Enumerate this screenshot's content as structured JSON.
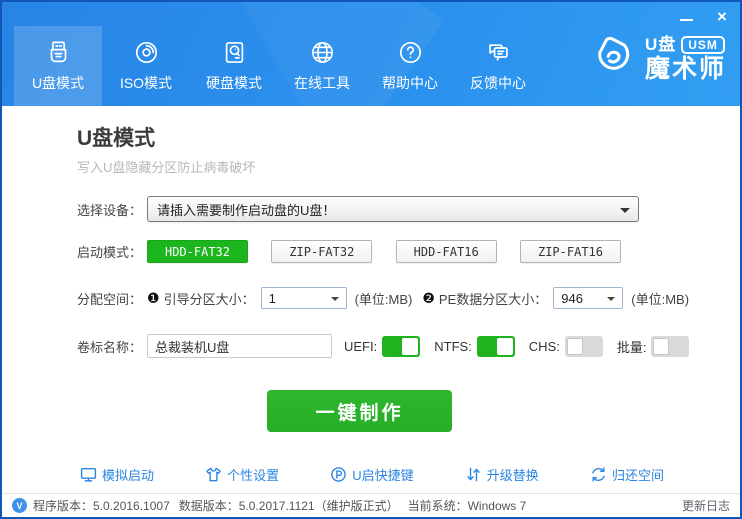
{
  "window": {
    "minimize_label": "minimize",
    "close_glyph": "×"
  },
  "nav": {
    "items": [
      {
        "label": "U盘模式",
        "icon": "usb-drive-icon",
        "active": true
      },
      {
        "label": "ISO模式",
        "icon": "disc-icon",
        "active": false
      },
      {
        "label": "硬盘模式",
        "icon": "hard-disk-icon",
        "active": false
      },
      {
        "label": "在线工具",
        "icon": "globe-icon",
        "active": false
      },
      {
        "label": "帮助中心",
        "icon": "question-icon",
        "active": false
      },
      {
        "label": "反馈中心",
        "icon": "feedback-icon",
        "active": false
      }
    ]
  },
  "logo": {
    "product": "U盘",
    "badge": "USM",
    "brand": "魔术师"
  },
  "main": {
    "title": "U盘模式",
    "subtitle": "写入U盘隐藏分区防止病毒破坏",
    "device": {
      "label": "选择设备：",
      "value": "请插入需要制作启动盘的U盘！"
    },
    "boot_mode": {
      "label": "启动模式：",
      "options": [
        {
          "label": "HDD-FAT32",
          "selected": true
        },
        {
          "label": "ZIP-FAT32",
          "selected": false
        },
        {
          "label": "HDD-FAT16",
          "selected": false
        },
        {
          "label": "ZIP-FAT16",
          "selected": false
        }
      ]
    },
    "allocation": {
      "label": "分配空间：",
      "boot_partition": {
        "bullet": "❶",
        "label": "引导分区大小：",
        "value": "1",
        "unit": "(单位:MB)"
      },
      "pe_partition": {
        "bullet": "❷",
        "label": "PE数据分区大小：",
        "value": "946",
        "unit": "(单位:MB)"
      }
    },
    "volume": {
      "label": "卷标名称：",
      "value": "总裁装机U盘"
    },
    "toggles": [
      {
        "label": "UEFI:",
        "on": true
      },
      {
        "label": "NTFS:",
        "on": true
      },
      {
        "label": "CHS:",
        "on": false
      },
      {
        "label": "批量:",
        "on": false
      }
    ],
    "make_button": "一键制作",
    "links": [
      {
        "label": "模拟启动",
        "icon": "monitor-icon"
      },
      {
        "label": "个性设置",
        "icon": "tshirt-icon"
      },
      {
        "label": "U启快捷键",
        "icon": "hotkey-icon"
      },
      {
        "label": "升级替换",
        "icon": "swap-arrows-icon"
      },
      {
        "label": "归还空间",
        "icon": "restore-icon"
      }
    ]
  },
  "statusbar": {
    "badge": "V",
    "program_version": "程序版本：5.0.2016.1007",
    "data_version": "数据版本：5.0.2017.1121（维护版正式）",
    "system": "当前系统：Windows 7",
    "update_link": "更新日志"
  },
  "colors": {
    "accent_blue": "#2089ec",
    "green": "#1fb41f",
    "link_blue": "#2b85e2"
  }
}
